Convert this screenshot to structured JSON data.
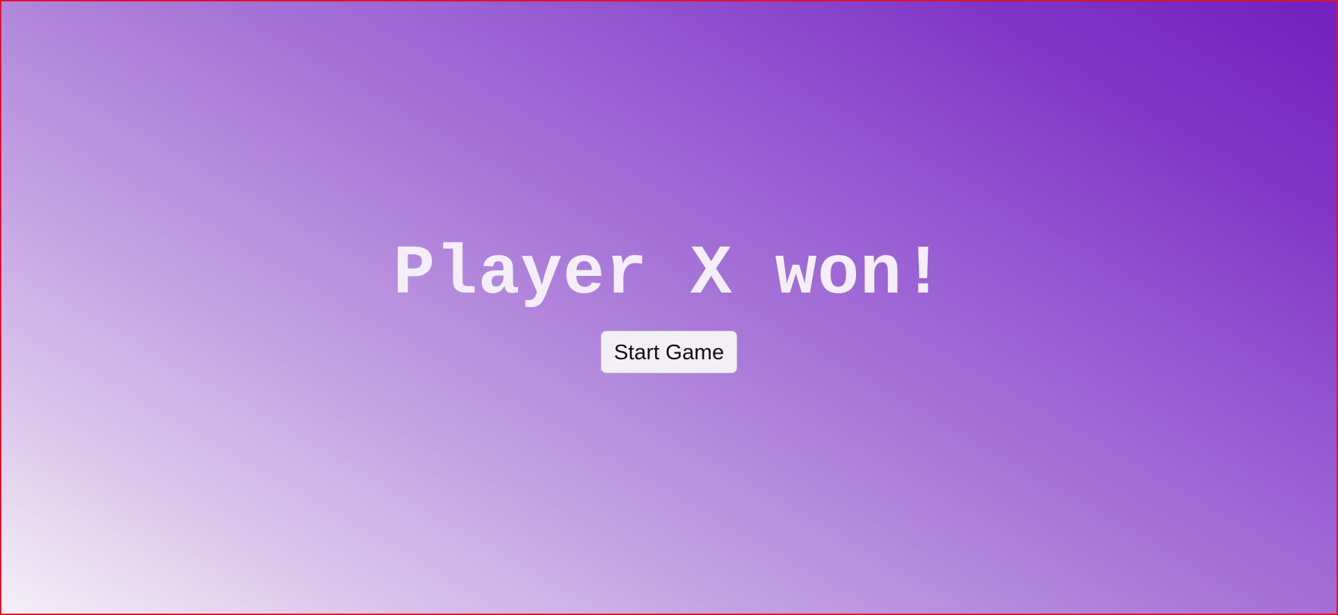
{
  "game": {
    "status_message": "Player X won!",
    "start_button_label": "Start Game"
  },
  "colors": {
    "gradient_light": "#f5f0f8",
    "gradient_dark": "#7320bf",
    "text": "#f4eef8",
    "frame_border": "#e0102a",
    "button_background": "#f2f0f3"
  }
}
